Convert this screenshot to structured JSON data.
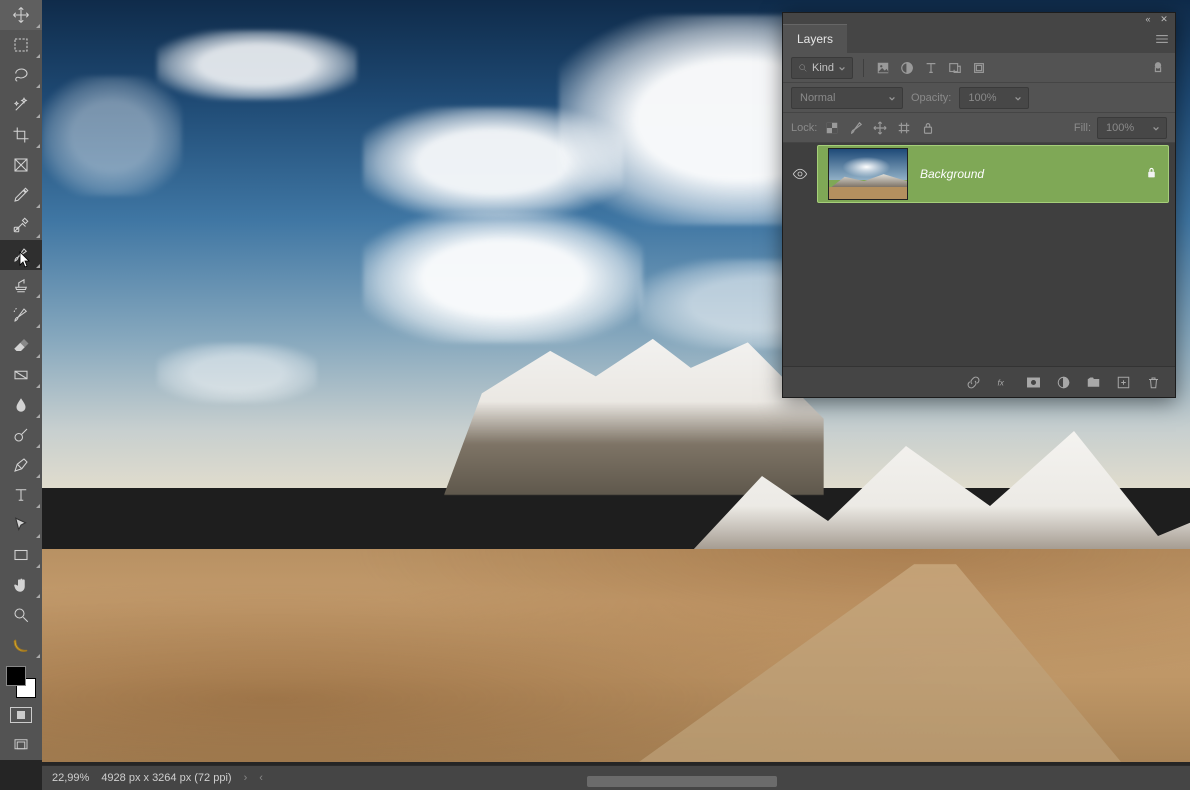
{
  "toolbar": {
    "tools": [
      {
        "name": "move-tool",
        "tri": true
      },
      {
        "name": "marquee-tool",
        "tri": true
      },
      {
        "name": "lasso-tool",
        "tri": true
      },
      {
        "name": "magic-wand-tool",
        "tri": true
      },
      {
        "name": "crop-tool",
        "tri": true
      },
      {
        "name": "frame-tool",
        "tri": false
      },
      {
        "name": "eyedropper-tool",
        "tri": true
      },
      {
        "name": "healing-brush-tool",
        "tri": true
      },
      {
        "name": "brush-tool",
        "tri": true,
        "active": true
      },
      {
        "name": "clone-stamp-tool",
        "tri": true
      },
      {
        "name": "history-brush-tool",
        "tri": true
      },
      {
        "name": "eraser-tool",
        "tri": true
      },
      {
        "name": "gradient-tool",
        "tri": true
      },
      {
        "name": "blur-tool",
        "tri": true
      },
      {
        "name": "dodge-tool",
        "tri": true
      },
      {
        "name": "pen-tool",
        "tri": true
      },
      {
        "name": "type-tool",
        "tri": true
      },
      {
        "name": "path-selection-tool",
        "tri": true
      },
      {
        "name": "rectangle-shape-tool",
        "tri": true
      },
      {
        "name": "hand-tool",
        "tri": true
      },
      {
        "name": "zoom-tool",
        "tri": false
      },
      {
        "name": "banana-tool",
        "tri": true
      }
    ],
    "foreground_color": "#000000",
    "background_color": "#ffffff"
  },
  "layers_panel": {
    "tab_label": "Layers",
    "filter": {
      "label": "Kind"
    },
    "filter_icons": [
      "pixel",
      "adjustment",
      "type",
      "shape",
      "smartobject"
    ],
    "blend_mode": "Normal",
    "opacity_label": "Opacity:",
    "opacity_value": "100%",
    "lock_label": "Lock:",
    "lock_icons": [
      "transparency",
      "brush",
      "position",
      "artboard",
      "all"
    ],
    "fill_label": "Fill:",
    "fill_value": "100%",
    "layers": [
      {
        "name": "Background",
        "visible": true,
        "locked": true,
        "selected": true
      }
    ],
    "footer_icons": [
      "link",
      "fx",
      "mask",
      "adjustment",
      "group",
      "new",
      "trash"
    ]
  },
  "statusbar": {
    "zoom": "22,99%",
    "doc_info": "4928 px x 3264 px (72 ppi)"
  }
}
